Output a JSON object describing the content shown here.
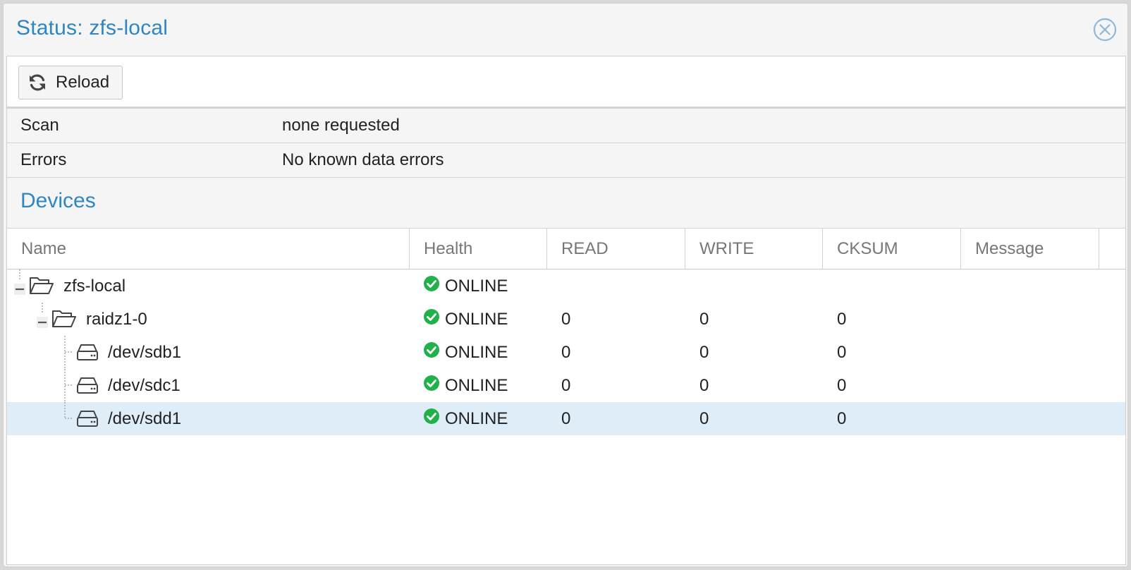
{
  "window": {
    "title": "Status: zfs-local",
    "close_icon": "close-icon"
  },
  "toolbar": {
    "reload_label": "Reload",
    "reload_icon": "refresh-icon"
  },
  "props": [
    {
      "key": "Scan",
      "value": "none requested"
    },
    {
      "key": "Errors",
      "value": "No known data errors"
    }
  ],
  "devices": {
    "title": "Devices",
    "columns": [
      "Name",
      "Health",
      "READ",
      "WRITE",
      "CKSUM",
      "Message"
    ],
    "rows": [
      {
        "name": "zfs-local",
        "health": "ONLINE",
        "read": "",
        "write": "",
        "cksum": "",
        "message": "",
        "type": "folder-open-icon",
        "level": 0,
        "expanded": true
      },
      {
        "name": "raidz1-0",
        "health": "ONLINE",
        "read": "0",
        "write": "0",
        "cksum": "0",
        "message": "",
        "type": "folder-open-icon",
        "level": 1,
        "expanded": true
      },
      {
        "name": "/dev/sdb1",
        "health": "ONLINE",
        "read": "0",
        "write": "0",
        "cksum": "0",
        "message": "",
        "type": "hard-drive-icon",
        "level": 2
      },
      {
        "name": "/dev/sdc1",
        "health": "ONLINE",
        "read": "0",
        "write": "0",
        "cksum": "0",
        "message": "",
        "type": "hard-drive-icon",
        "level": 2
      },
      {
        "name": "/dev/sdd1",
        "health": "ONLINE",
        "read": "0",
        "write": "0",
        "cksum": "0",
        "message": "",
        "type": "hard-drive-icon",
        "level": 2,
        "selected": true
      }
    ]
  },
  "colors": {
    "accent": "#2f86c2",
    "selected_row": "#dfedf8",
    "online_green": "#21b14b"
  }
}
